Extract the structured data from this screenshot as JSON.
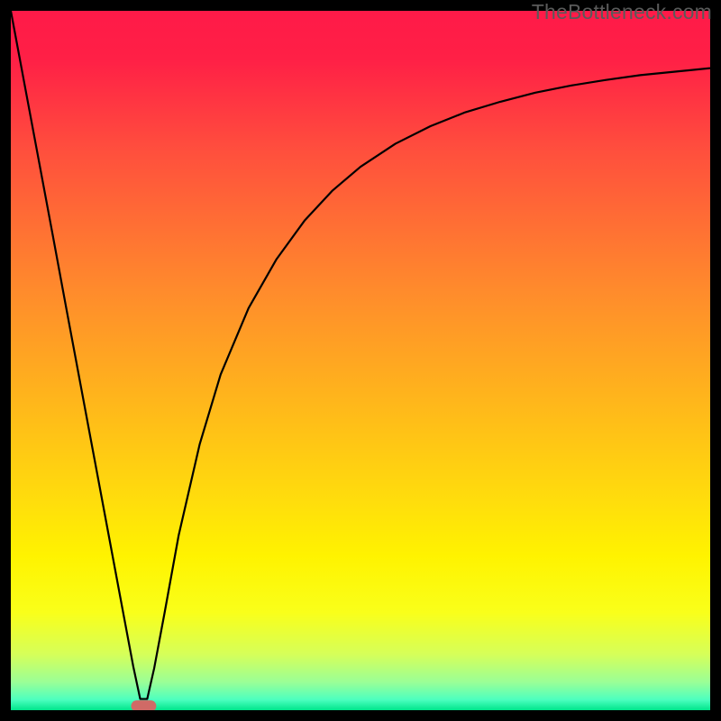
{
  "watermark": "TheBottleneck.com",
  "chart_data": {
    "type": "line",
    "title": "",
    "xlabel": "",
    "ylabel": "",
    "xlim": [
      0,
      100
    ],
    "ylim": [
      0,
      100
    ],
    "grid": false,
    "legend": false,
    "gradient_background": {
      "direction": "vertical",
      "stops": [
        {
          "offset": 0.0,
          "color": "#ff1a48"
        },
        {
          "offset": 0.07,
          "color": "#ff2046"
        },
        {
          "offset": 0.2,
          "color": "#ff4f3d"
        },
        {
          "offset": 0.4,
          "color": "#ff8b2c"
        },
        {
          "offset": 0.55,
          "color": "#ffb41c"
        },
        {
          "offset": 0.7,
          "color": "#ffdd0c"
        },
        {
          "offset": 0.78,
          "color": "#fff300"
        },
        {
          "offset": 0.86,
          "color": "#f9ff1a"
        },
        {
          "offset": 0.92,
          "color": "#d6ff59"
        },
        {
          "offset": 0.96,
          "color": "#9aff97"
        },
        {
          "offset": 0.985,
          "color": "#4cffbf"
        },
        {
          "offset": 1.0,
          "color": "#00e58b"
        }
      ]
    },
    "series": [
      {
        "name": "bottleneck-curve",
        "color": "#000000",
        "stroke_width": 2.2,
        "x": [
          0,
          2,
          4,
          6,
          8,
          10,
          12,
          14,
          16,
          17.5,
          18.5,
          19.5,
          20.5,
          22,
          24,
          27,
          30,
          34,
          38,
          42,
          46,
          50,
          55,
          60,
          65,
          70,
          75,
          80,
          85,
          90,
          95,
          100
        ],
        "y": [
          100,
          89.3,
          78.6,
          67.9,
          57.1,
          46.4,
          35.7,
          25.0,
          14.3,
          6.3,
          1.6,
          1.6,
          6.0,
          14.0,
          25.0,
          38.0,
          48.0,
          57.5,
          64.5,
          70.0,
          74.3,
          77.7,
          81.0,
          83.5,
          85.5,
          87.0,
          88.3,
          89.3,
          90.1,
          90.8,
          91.3,
          91.8
        ]
      }
    ],
    "markers": [
      {
        "name": "optimal-marker",
        "shape": "rounded-rect",
        "x": 19.0,
        "y": 0.6,
        "width": 3.6,
        "height": 1.6,
        "fill": "#d06a66",
        "stroke": "none"
      }
    ]
  }
}
